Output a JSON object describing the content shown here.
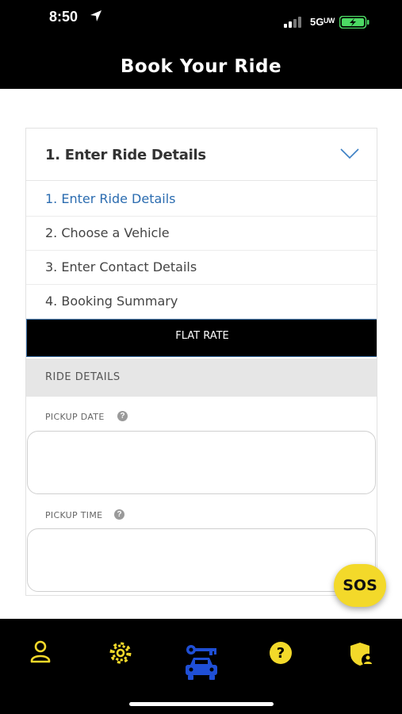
{
  "status_bar": {
    "time": "8:50",
    "network": "5Gᵁᵂ"
  },
  "header": {
    "title": "Book Your Ride"
  },
  "steps": {
    "selected": "1. Enter Ride Details",
    "options": [
      "1. Enter Ride Details",
      "2. Choose a Vehicle",
      "3. Enter Contact Details",
      "4. Booking Summary"
    ]
  },
  "rate_button": "FLAT RATE",
  "section": {
    "title": "RIDE DETAILS"
  },
  "fields": {
    "pickup_date": {
      "label": "PICKUP DATE",
      "value": ""
    },
    "pickup_time": {
      "label": "PICKUP TIME",
      "value": ""
    }
  },
  "sos_label": "SOS",
  "bottom_nav": {
    "items": [
      "profile-icon",
      "settings-icon",
      "ride-icon",
      "help-icon",
      "security-icon"
    ]
  },
  "colors": {
    "header_bg": "#000000",
    "accent_yellow": "#f3d92a",
    "active_step": "#2b6cb0",
    "ride_icon_blue": "#1f4fd6"
  }
}
